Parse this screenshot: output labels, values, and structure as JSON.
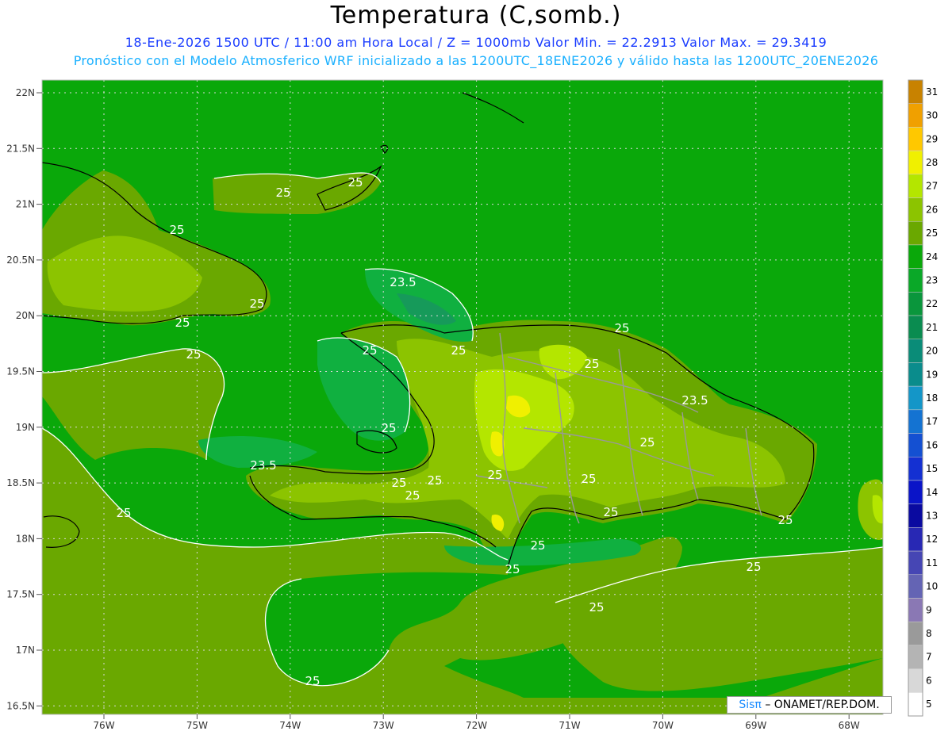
{
  "header": {
    "title": "Temperatura (C,somb.)",
    "subtitle_line1": "18-Ene-2026 1500 UTC / 11:00 am Hora Local / Z = 1000mb  Valor Min. = 22.2913  Valor Max. = 29.3419",
    "subtitle_line2": "Pronóstico con el Modelo Atmosferico WRF inicializado a las 1200UTC_18ENE2026 y válido hasta las  1200UTC_20ENE2026"
  },
  "map": {
    "lat_labels": [
      "22N",
      "21.5N",
      "21N",
      "20.5N",
      "20N",
      "19.5N",
      "19N",
      "18.5N",
      "18N",
      "17.5N",
      "17N",
      "16.5N"
    ],
    "lon_labels": [
      "76W",
      "75W",
      "74W",
      "73W",
      "72W",
      "71W",
      "70W",
      "69W",
      "68W"
    ],
    "contour_labels": [
      {
        "text": "25"
      },
      {
        "text": "25"
      },
      {
        "text": "25"
      },
      {
        "text": "25"
      },
      {
        "text": "25"
      },
      {
        "text": "23.5"
      },
      {
        "text": "25"
      },
      {
        "text": "25"
      },
      {
        "text": "25"
      },
      {
        "text": "25"
      },
      {
        "text": "25"
      },
      {
        "text": "23.5"
      },
      {
        "text": "25"
      },
      {
        "text": "23.5"
      },
      {
        "text": "25"
      },
      {
        "text": "25"
      },
      {
        "text": "25"
      },
      {
        "text": "25"
      },
      {
        "text": "25"
      },
      {
        "text": "25"
      },
      {
        "text": "25"
      },
      {
        "text": "25"
      },
      {
        "text": "25"
      },
      {
        "text": "25"
      },
      {
        "text": "25"
      },
      {
        "text": "25"
      },
      {
        "text": "25"
      },
      {
        "text": "25"
      }
    ],
    "colors": {
      "v24": "#0aa80a",
      "v25": "#6aa800",
      "v26": "#8cc400",
      "v27": "#b4e600",
      "v23": "#10b040",
      "v22": "#169a5a"
    }
  },
  "colorbar": {
    "levels": [
      "5",
      "6",
      "7",
      "8",
      "9",
      "10",
      "11",
      "12",
      "13",
      "14",
      "15",
      "16",
      "17",
      "18",
      "19",
      "20",
      "21",
      "22",
      "23",
      "24",
      "25",
      "26",
      "27",
      "28",
      "29",
      "30",
      "31"
    ],
    "colors": [
      "#ffffff",
      "#d8d8d8",
      "#b4b4b4",
      "#9a9a9a",
      "#8a78b4",
      "#6464b4",
      "#4646b4",
      "#2828b4",
      "#0a0aa0",
      "#0a14c8",
      "#1430d2",
      "#1450d2",
      "#1473d2",
      "#1496c8",
      "#0a8c8c",
      "#0a8c78",
      "#0a8c50",
      "#0a963c",
      "#0aa828",
      "#0aa80a",
      "#6aa800",
      "#8cc400",
      "#b4e600",
      "#f0f000",
      "#ffc800",
      "#f0a000",
      "#c88200"
    ]
  },
  "credit": {
    "brand": "Sisπ",
    "text": "– ONAMET/REP.DOM."
  }
}
